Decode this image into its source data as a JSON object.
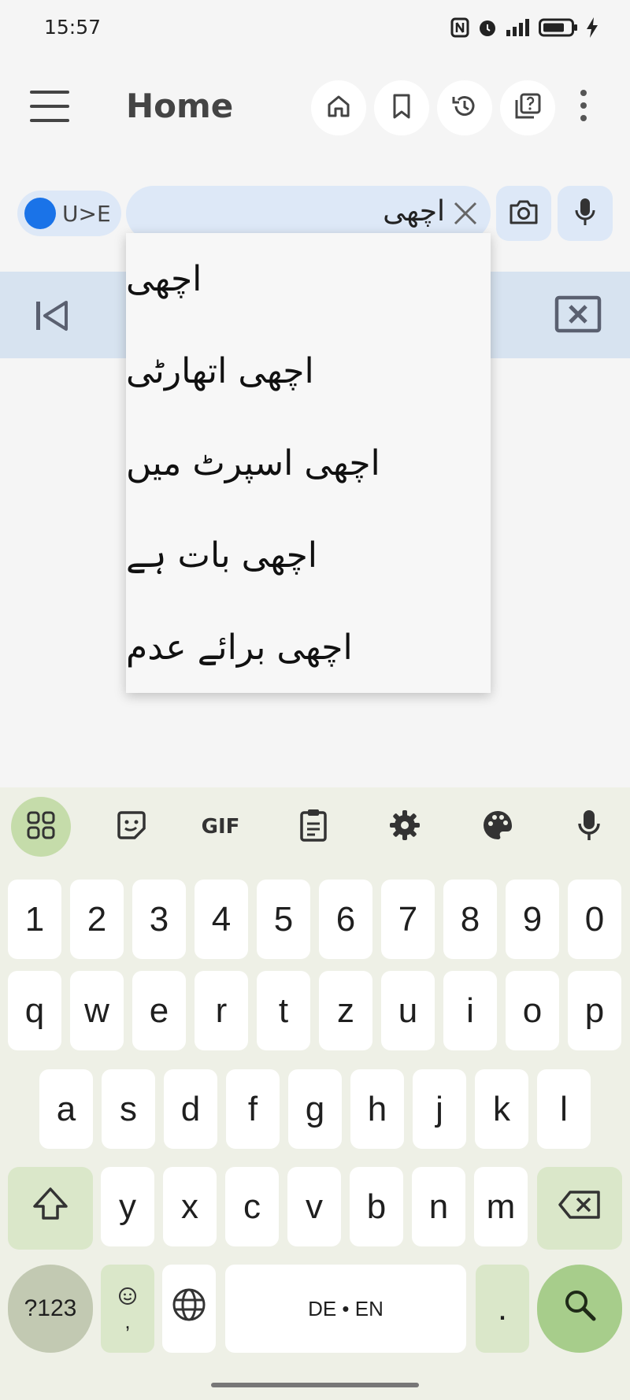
{
  "status_bar": {
    "time": "15:57"
  },
  "app_bar": {
    "title": "Home"
  },
  "search": {
    "direction_label": "U>E",
    "query": "اچھی"
  },
  "suggestions": [
    "اچھی",
    "اچھی اتھارٹی",
    "اچھی اسپرٹ میں",
    "اچھی بات ہے",
    "اچھی برائے عدم"
  ],
  "keyboard": {
    "number_row": [
      "1",
      "2",
      "3",
      "4",
      "5",
      "6",
      "7",
      "8",
      "9",
      "0"
    ],
    "row1": [
      "q",
      "w",
      "e",
      "r",
      "t",
      "z",
      "u",
      "i",
      "o",
      "p"
    ],
    "row2": [
      "a",
      "s",
      "d",
      "f",
      "g",
      "h",
      "j",
      "k",
      "l"
    ],
    "row3": [
      "y",
      "x",
      "c",
      "v",
      "b",
      "n",
      "m"
    ],
    "symbols_label": "?123",
    "gif_label": "GIF",
    "emoji_comma": ",",
    "space_label": "DE • EN",
    "period_label": "."
  },
  "colors": {
    "accent": "#1a73e8",
    "search_bg": "#dde8f7",
    "keyboard_bg": "#eef0e6",
    "action_key": "#a7cd8b"
  }
}
